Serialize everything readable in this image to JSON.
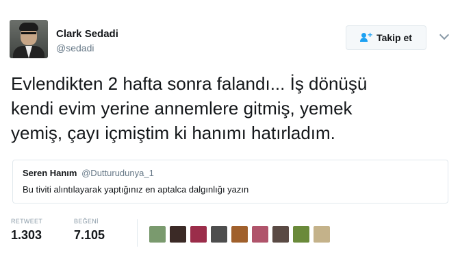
{
  "author": {
    "name": "Clark Sedadi",
    "handle": "@sedadi"
  },
  "follow_button": {
    "label": "Takip et",
    "icon": "add-user-icon",
    "accent_color": "#1da1f2"
  },
  "menu_icon": "chevron-down-icon",
  "tweet": {
    "text": "Evlendikten 2 hafta sonra falandı... İş dönüşü\nkendi evim yerine annemlere gitmiş, yemek\nyemiş, çayı içmiştim ki hanımı hatırladım."
  },
  "quoted_tweet": {
    "name": "Seren Hanım",
    "handle": "@Dutturudunya_1",
    "text": "Bu tiviti alıntılayarak yaptığınız en aptalca dalgınlığı yazın"
  },
  "stats": {
    "retweet_label": "RETWEET",
    "retweet_count": "1.303",
    "like_label": "BEĞENİ",
    "like_count": "7.105"
  },
  "likers": [
    {
      "name": "liker-avatar-1",
      "color": "#7a9a6e"
    },
    {
      "name": "liker-avatar-2",
      "color": "#3b2a26"
    },
    {
      "name": "liker-avatar-3",
      "color": "#9b2d4a"
    },
    {
      "name": "liker-avatar-4",
      "color": "#4e4e4e"
    },
    {
      "name": "liker-avatar-5",
      "color": "#a0602c"
    },
    {
      "name": "liker-avatar-6",
      "color": "#b0546b"
    },
    {
      "name": "liker-avatar-7",
      "color": "#5a4a44"
    },
    {
      "name": "liker-avatar-8",
      "color": "#6a8a3a"
    },
    {
      "name": "liker-avatar-9",
      "color": "#c4b28a"
    }
  ]
}
